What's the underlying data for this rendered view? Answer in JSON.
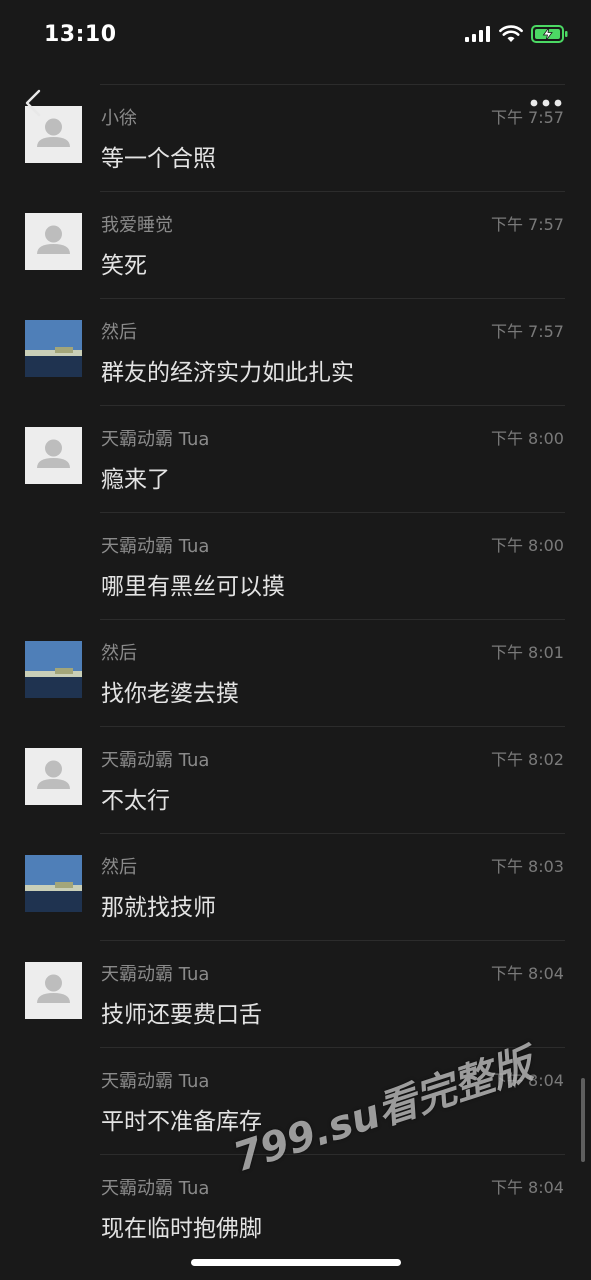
{
  "status_bar": {
    "time": "13:10"
  },
  "icons": {
    "back": "chevron-left-icon",
    "more": "more-dots-icon",
    "signal": "cellular-signal-icon",
    "wifi": "wifi-icon",
    "battery": "battery-charging-icon"
  },
  "colors": {
    "background": "#191919",
    "battery_fill": "#4cd964"
  },
  "messages": [
    {
      "sender": "小徐",
      "time": "下午 7:57",
      "content": "等一个合照"
    },
    {
      "sender": "我爱睡觉",
      "time": "下午 7:57",
      "content": "笑死"
    },
    {
      "sender": "然后",
      "time": "下午 7:57",
      "content": "群友的经济实力如此扎实"
    },
    {
      "sender": "天霸动霸 Tua",
      "time": "下午 8:00",
      "content": "瘾来了"
    },
    {
      "sender": "天霸动霸 Tua",
      "time": "下午 8:00",
      "content": "哪里有黑丝可以摸"
    },
    {
      "sender": "然后",
      "time": "下午 8:01",
      "content": "找你老婆去摸"
    },
    {
      "sender": "天霸动霸 Tua",
      "time": "下午 8:02",
      "content": "不太行"
    },
    {
      "sender": "然后",
      "time": "下午 8:03",
      "content": "那就找技师"
    },
    {
      "sender": "天霸动霸 Tua",
      "time": "下午 8:04",
      "content": "技师还要费口舌"
    },
    {
      "sender": "天霸动霸 Tua",
      "time": "下午 8:04",
      "content": "平时不准备库存"
    },
    {
      "sender": "天霸动霸 Tua",
      "time": "下午 8:04",
      "content": "现在临时抱佛脚"
    }
  ],
  "watermark": "799.su看完整版"
}
